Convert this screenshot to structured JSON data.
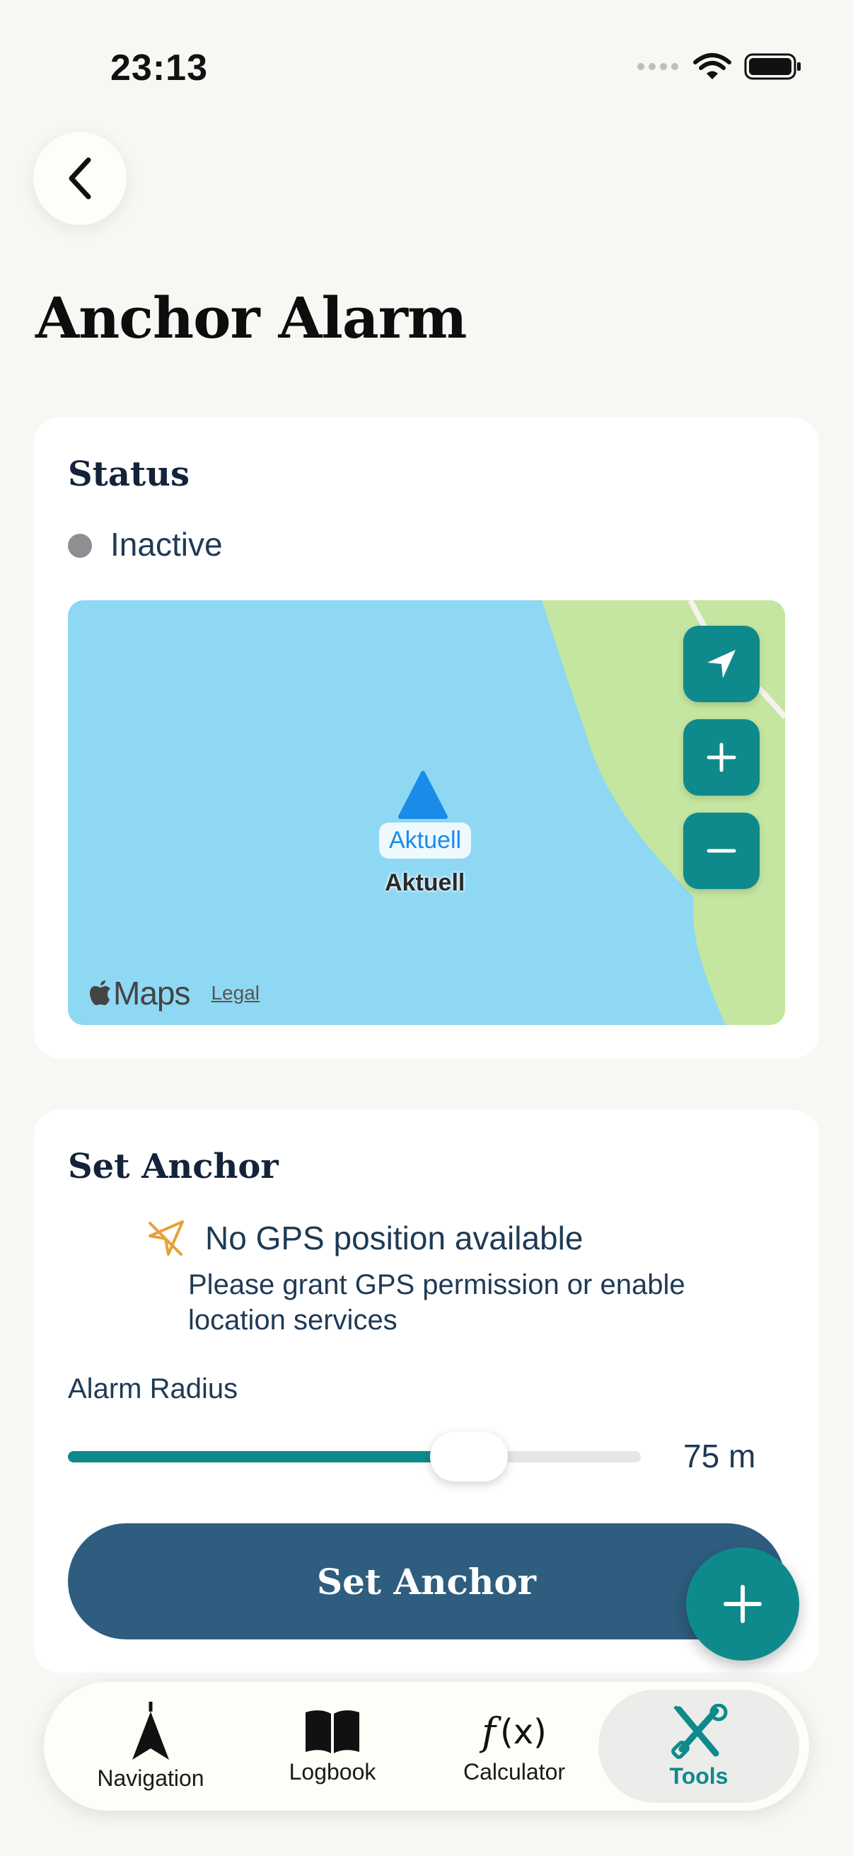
{
  "status_bar": {
    "time": "23:13"
  },
  "header": {
    "title": "Anchor Alarm"
  },
  "status_card": {
    "title": "Status",
    "state": "Inactive",
    "map": {
      "pin_bubble": "Aktuell",
      "pin_label": "Aktuell",
      "brand": "Maps",
      "legal": "Legal"
    }
  },
  "anchor_card": {
    "title": "Set Anchor",
    "gps_title": "No GPS position available",
    "gps_subtitle_line1": "Please grant GPS permission or enable",
    "gps_subtitle_line2": "location services",
    "radius_label": "Alarm Radius",
    "radius_value": "75 m",
    "radius_fraction": 0.7,
    "button_label": "Set Anchor"
  },
  "tabbar": {
    "tabs": [
      {
        "label": "Navigation",
        "icon": "navigation-arrow-icon"
      },
      {
        "label": "Logbook",
        "icon": "book-icon"
      },
      {
        "label": "Calculator",
        "icon": "function-icon"
      },
      {
        "label": "Tools",
        "icon": "tools-icon",
        "active": true
      }
    ]
  },
  "colors": {
    "accent": "#0e8a8c",
    "primary_button": "#2e5d7f",
    "water": "#8fd8f3",
    "land": "#c5e6a0",
    "inactive_dot": "#8f8f93",
    "warning": "#e8a03a"
  }
}
